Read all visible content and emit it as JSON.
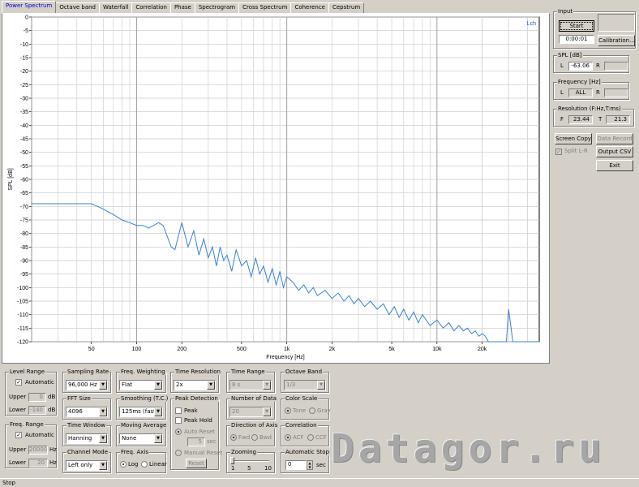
{
  "tabs": [
    "Power Spectrum",
    "Octave band",
    "Waterfall",
    "Correlation",
    "Phase",
    "Spectrogram",
    "Cross Spectrum",
    "Coherence",
    "Cepstrum"
  ],
  "plot": {
    "channel": "Lch",
    "ylabel": "SPL [dB]",
    "xlabel": "Frequency [Hz]"
  },
  "chart_data": {
    "type": "line",
    "xlabel": "Frequency [Hz]",
    "ylabel": "SPL [dB]",
    "xscale": "log",
    "xlim": [
      20,
      48000
    ],
    "ylim": [
      -120,
      0
    ],
    "yticks": [
      "0",
      "-5",
      "-10",
      "-15",
      "-20",
      "-25",
      "-30",
      "-35",
      "-40",
      "-45",
      "-50",
      "-55",
      "-60",
      "-65",
      "-70",
      "-75",
      "-80",
      "-85",
      "-90",
      "-95",
      "-100",
      "-105",
      "-110",
      "-115",
      "-120"
    ],
    "xticks": [
      "50",
      "100",
      "200",
      "500",
      "1k",
      "2k",
      "5k",
      "10k",
      "20k"
    ],
    "series": [
      {
        "color": "#3a7fd5",
        "x": [
          20,
          25,
          30,
          35,
          40,
          45,
          50,
          55,
          60,
          70,
          80,
          90,
          100,
          110,
          120,
          130,
          140,
          150,
          160,
          170,
          180,
          200,
          220,
          240,
          260,
          280,
          300,
          320,
          340,
          360,
          380,
          400,
          430,
          460,
          500,
          540,
          580,
          620,
          660,
          700,
          750,
          800,
          850,
          900,
          950,
          1000,
          1100,
          1200,
          1300,
          1400,
          1500,
          1600,
          1800,
          2000,
          2200,
          2400,
          2600,
          2800,
          3000,
          3300,
          3600,
          4000,
          4400,
          4800,
          5200,
          5600,
          6000,
          6500,
          7000,
          7500,
          8000,
          9000,
          10000,
          11000,
          12000,
          13000,
          14000,
          15000,
          16000,
          17000,
          18000,
          19000,
          20000,
          21000,
          22000,
          22100,
          23000,
          25000,
          27000,
          28000,
          28500,
          29000,
          30000,
          32000,
          33000,
          34000,
          36000,
          38000,
          40000,
          44000,
          48000
        ],
        "y": [
          -69,
          -69,
          -69,
          -69,
          -69,
          -69,
          -69,
          -70,
          -71,
          -73,
          -75,
          -76,
          -77,
          -77,
          -78,
          -77,
          -76,
          -77,
          -81,
          -85,
          -86,
          -76,
          -85,
          -79,
          -88,
          -82,
          -89,
          -85,
          -92,
          -85,
          -90,
          -88,
          -94,
          -86,
          -92,
          -90,
          -96,
          -89,
          -95,
          -92,
          -98,
          -93,
          -99,
          -94,
          -100,
          -96,
          -98,
          -101,
          -99,
          -102,
          -100,
          -103,
          -101,
          -104,
          -102,
          -105,
          -103,
          -106,
          -104,
          -107,
          -105,
          -108,
          -106,
          -110,
          -107,
          -111,
          -108,
          -112,
          -109,
          -113,
          -110,
          -114,
          -112,
          -115,
          -113,
          -116,
          -114,
          -116,
          -115,
          -117,
          -116,
          -118,
          -117,
          -118,
          -120,
          -120,
          -120,
          -120,
          -120,
          -120,
          -120,
          -120,
          -108,
          -120,
          -120,
          -120,
          -120,
          -120,
          -120,
          -120,
          -120
        ]
      }
    ]
  },
  "input": {
    "label": "Input",
    "start": "Start",
    "time": "0:00:01",
    "calibration": "Calibration..."
  },
  "spl": {
    "label": "SPL [dB]",
    "l": "L",
    "l_val": "-63.06",
    "r": "R",
    "r_val": ""
  },
  "freq": {
    "label": "Frequency [Hz]",
    "l": "L",
    "l_val": "ALL",
    "r": "R",
    "r_val": ""
  },
  "res": {
    "label": "Resolution (F:Hz,T:ms)",
    "f": "F",
    "f_val": "23.44",
    "t": "T",
    "t_val": "21.3"
  },
  "buttons": {
    "screen_copy": "Screen Copy",
    "data_record": "Data Record",
    "split": "Split L-R",
    "output_csv": "Output CSV",
    "exit": "Exit"
  },
  "level": {
    "label": "Level Range",
    "auto": "Automatic",
    "upper": "Upper",
    "upper_val": "0",
    "lower": "Lower",
    "lower_val": "-140",
    "unit": "dB"
  },
  "freqrange": {
    "label": "Freq. Range",
    "auto": "Automatic",
    "upper": "Upper",
    "upper_val": "20000",
    "lower": "Lower",
    "lower_val": "20",
    "unit": "Hz"
  },
  "sampling": {
    "label": "Sampling Rate",
    "val": "96,000 Hz"
  },
  "fft": {
    "label": "FFT Size",
    "val": "4096"
  },
  "timewin": {
    "label": "Time Window",
    "val": "Hanning"
  },
  "chmode": {
    "label": "Channel Mode",
    "val": "Left only"
  },
  "weighting": {
    "label": "Freq. Weighting",
    "val": "Flat"
  },
  "smoothing": {
    "label": "Smoothing (T.C.)",
    "val": "125ms (fast)"
  },
  "movavg": {
    "label": "Moving Average",
    "val": "None"
  },
  "freqaxis": {
    "label": "Freq. Axis",
    "log": "Log",
    "linear": "Linear"
  },
  "timeres": {
    "label": "Time Resolution",
    "val": "2x"
  },
  "peak": {
    "label": "Peak Detection",
    "peak": "Peak",
    "hold": "Peak Hold",
    "auto": "Auto Reset",
    "sec_val": "5",
    "sec": "sec",
    "manual": "Manual Reset",
    "reset": "Reset"
  },
  "timerange": {
    "label": "Time Range",
    "val": "8 s"
  },
  "numdata": {
    "label": "Number of Data",
    "val": "20"
  },
  "dir": {
    "label": "Direction of Axis",
    "fwd": "Fwd",
    "bwd": "Bwd"
  },
  "zoom": {
    "label": "Zooming",
    "t1": "1",
    "t2": "5",
    "t3": "10"
  },
  "octave": {
    "label": "Octave Band",
    "val": "1/3"
  },
  "colorscale": {
    "label": "Color Scale",
    "tone": "Tone",
    "gray": "Gray"
  },
  "corr": {
    "label": "Correlation",
    "acf": "ACF",
    "ccf": "CCF"
  },
  "autostop": {
    "label": "Automatic Stop",
    "val": "0",
    "sec": "sec"
  },
  "status": "Stop",
  "watermark": "Datagor.ru"
}
